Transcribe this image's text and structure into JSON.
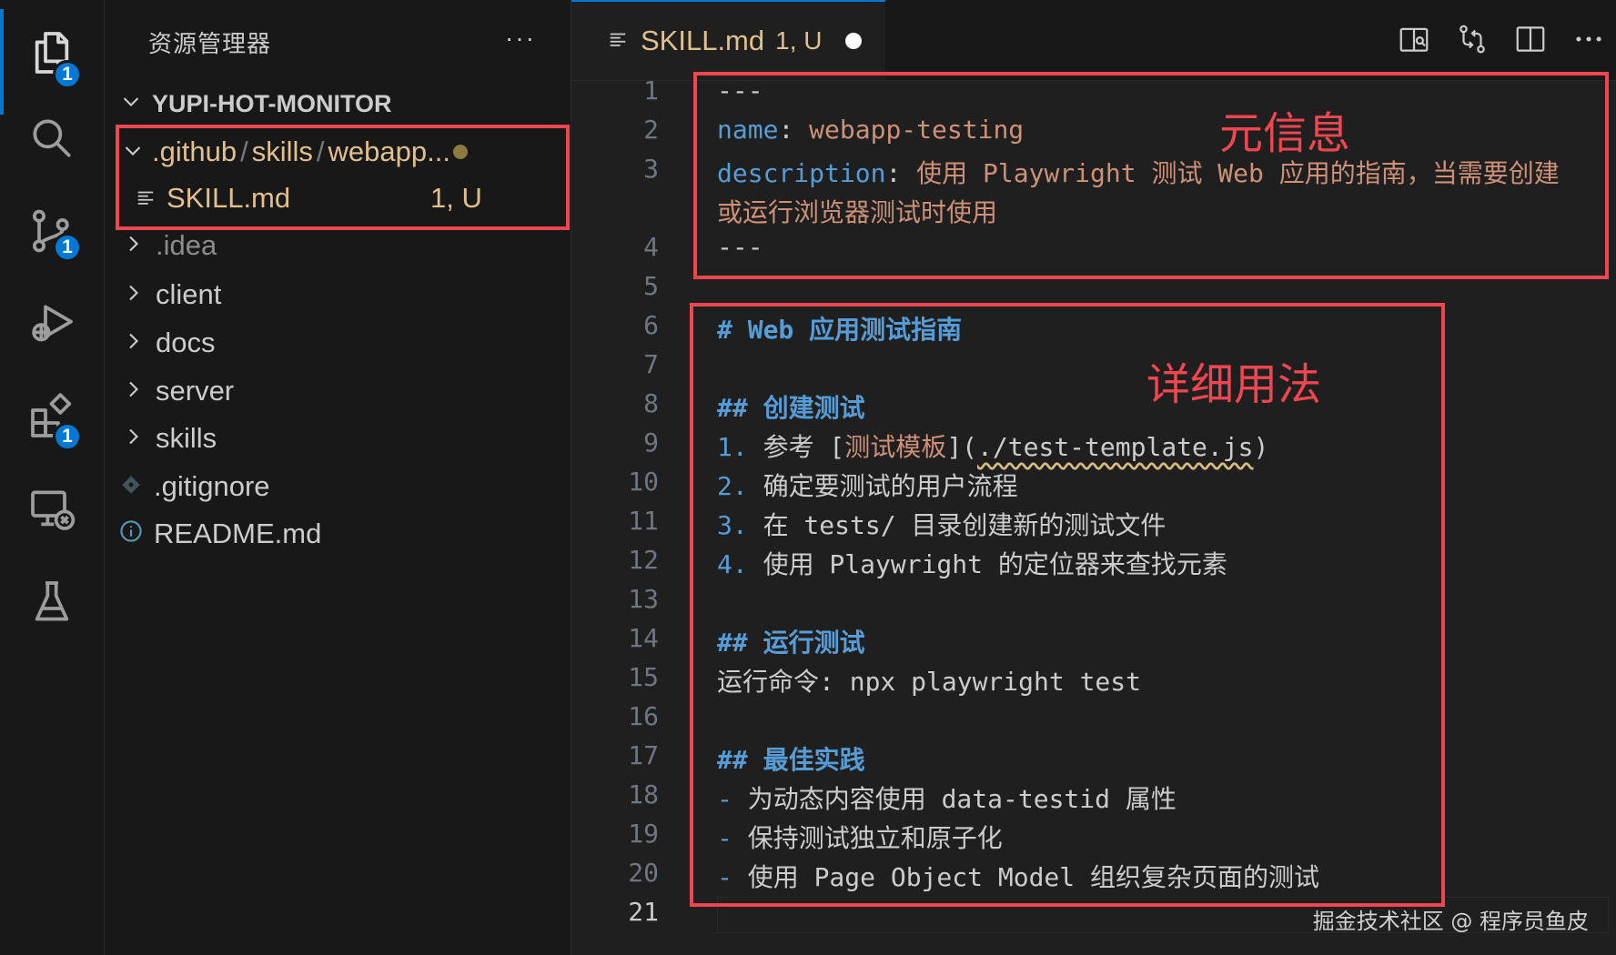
{
  "activity_bar": {
    "explorer_badge": "1",
    "source_control_badge": "1",
    "extensions_badge": "1"
  },
  "sidebar": {
    "title": "资源管理器",
    "more": "···",
    "root_folder": "YUPI-HOT-MONITOR",
    "open_folder": {
      "p1": ".github",
      "sep1": "/",
      "p2": "skills",
      "sep2": "/",
      "p3": "webapp..."
    },
    "open_file": {
      "name": "SKILL.md",
      "status": "1, U"
    },
    "folders": [
      ".idea",
      "client",
      "docs",
      "server",
      "skills"
    ],
    "files": [
      ".gitignore",
      "README.md"
    ]
  },
  "tab": {
    "name": "SKILL.md",
    "status": "1, U"
  },
  "editor": {
    "line_numbers": [
      "1",
      "2",
      "3",
      "4",
      "5",
      "6",
      "7",
      "8",
      "9",
      "10",
      "11",
      "12",
      "13",
      "14",
      "15",
      "16",
      "17",
      "18",
      "19",
      "20",
      "21"
    ],
    "lines": {
      "l1": "---",
      "l2_key": "name",
      "l2_colon": ":",
      "l2_val": " webapp-testing",
      "l3_key": "description",
      "l3_colon": ":",
      "l3_val": " 使用 Playwright 测试 Web 应用的指南，当需要创建",
      "l3_wrap": "或运行浏览器测试时使用",
      "l4": "---",
      "l6": "# Web 应用测试指南",
      "l8": "## 创建测试",
      "l9_num": "1.",
      "l9_a": " 参考 [",
      "l9_link": "测试模板",
      "l9_b": "](",
      "l9_url": "./test-template.js",
      "l9_c": ")",
      "l10_num": "2.",
      "l10": " 确定要测试的用户流程",
      "l11_num": "3.",
      "l11": " 在 tests/ 目录创建新的测试文件",
      "l12_num": "4.",
      "l12": " 使用 Playwright 的定位器来查找元素",
      "l14": "## 运行测试",
      "l15": "运行命令: npx playwright test",
      "l17": "## 最佳实践",
      "l18_dash": "-",
      "l18": " 为动态内容使用 data-testid 属性",
      "l19_dash": "-",
      "l19": " 保持测试独立和原子化",
      "l20_dash": "-",
      "l20": " 使用 Page Object Model 组织复杂页面的测试"
    }
  },
  "annotations": {
    "meta": "元信息",
    "usage": "详细用法"
  },
  "watermark": "掘金技术社区 @ 程序员鱼皮",
  "colors": {
    "accent": "#0078d4",
    "annotation_red": "#f0464f",
    "modified_yellow": "#e2c08d",
    "keyword_blue": "#569cd6",
    "string_orange": "#ce9178"
  }
}
